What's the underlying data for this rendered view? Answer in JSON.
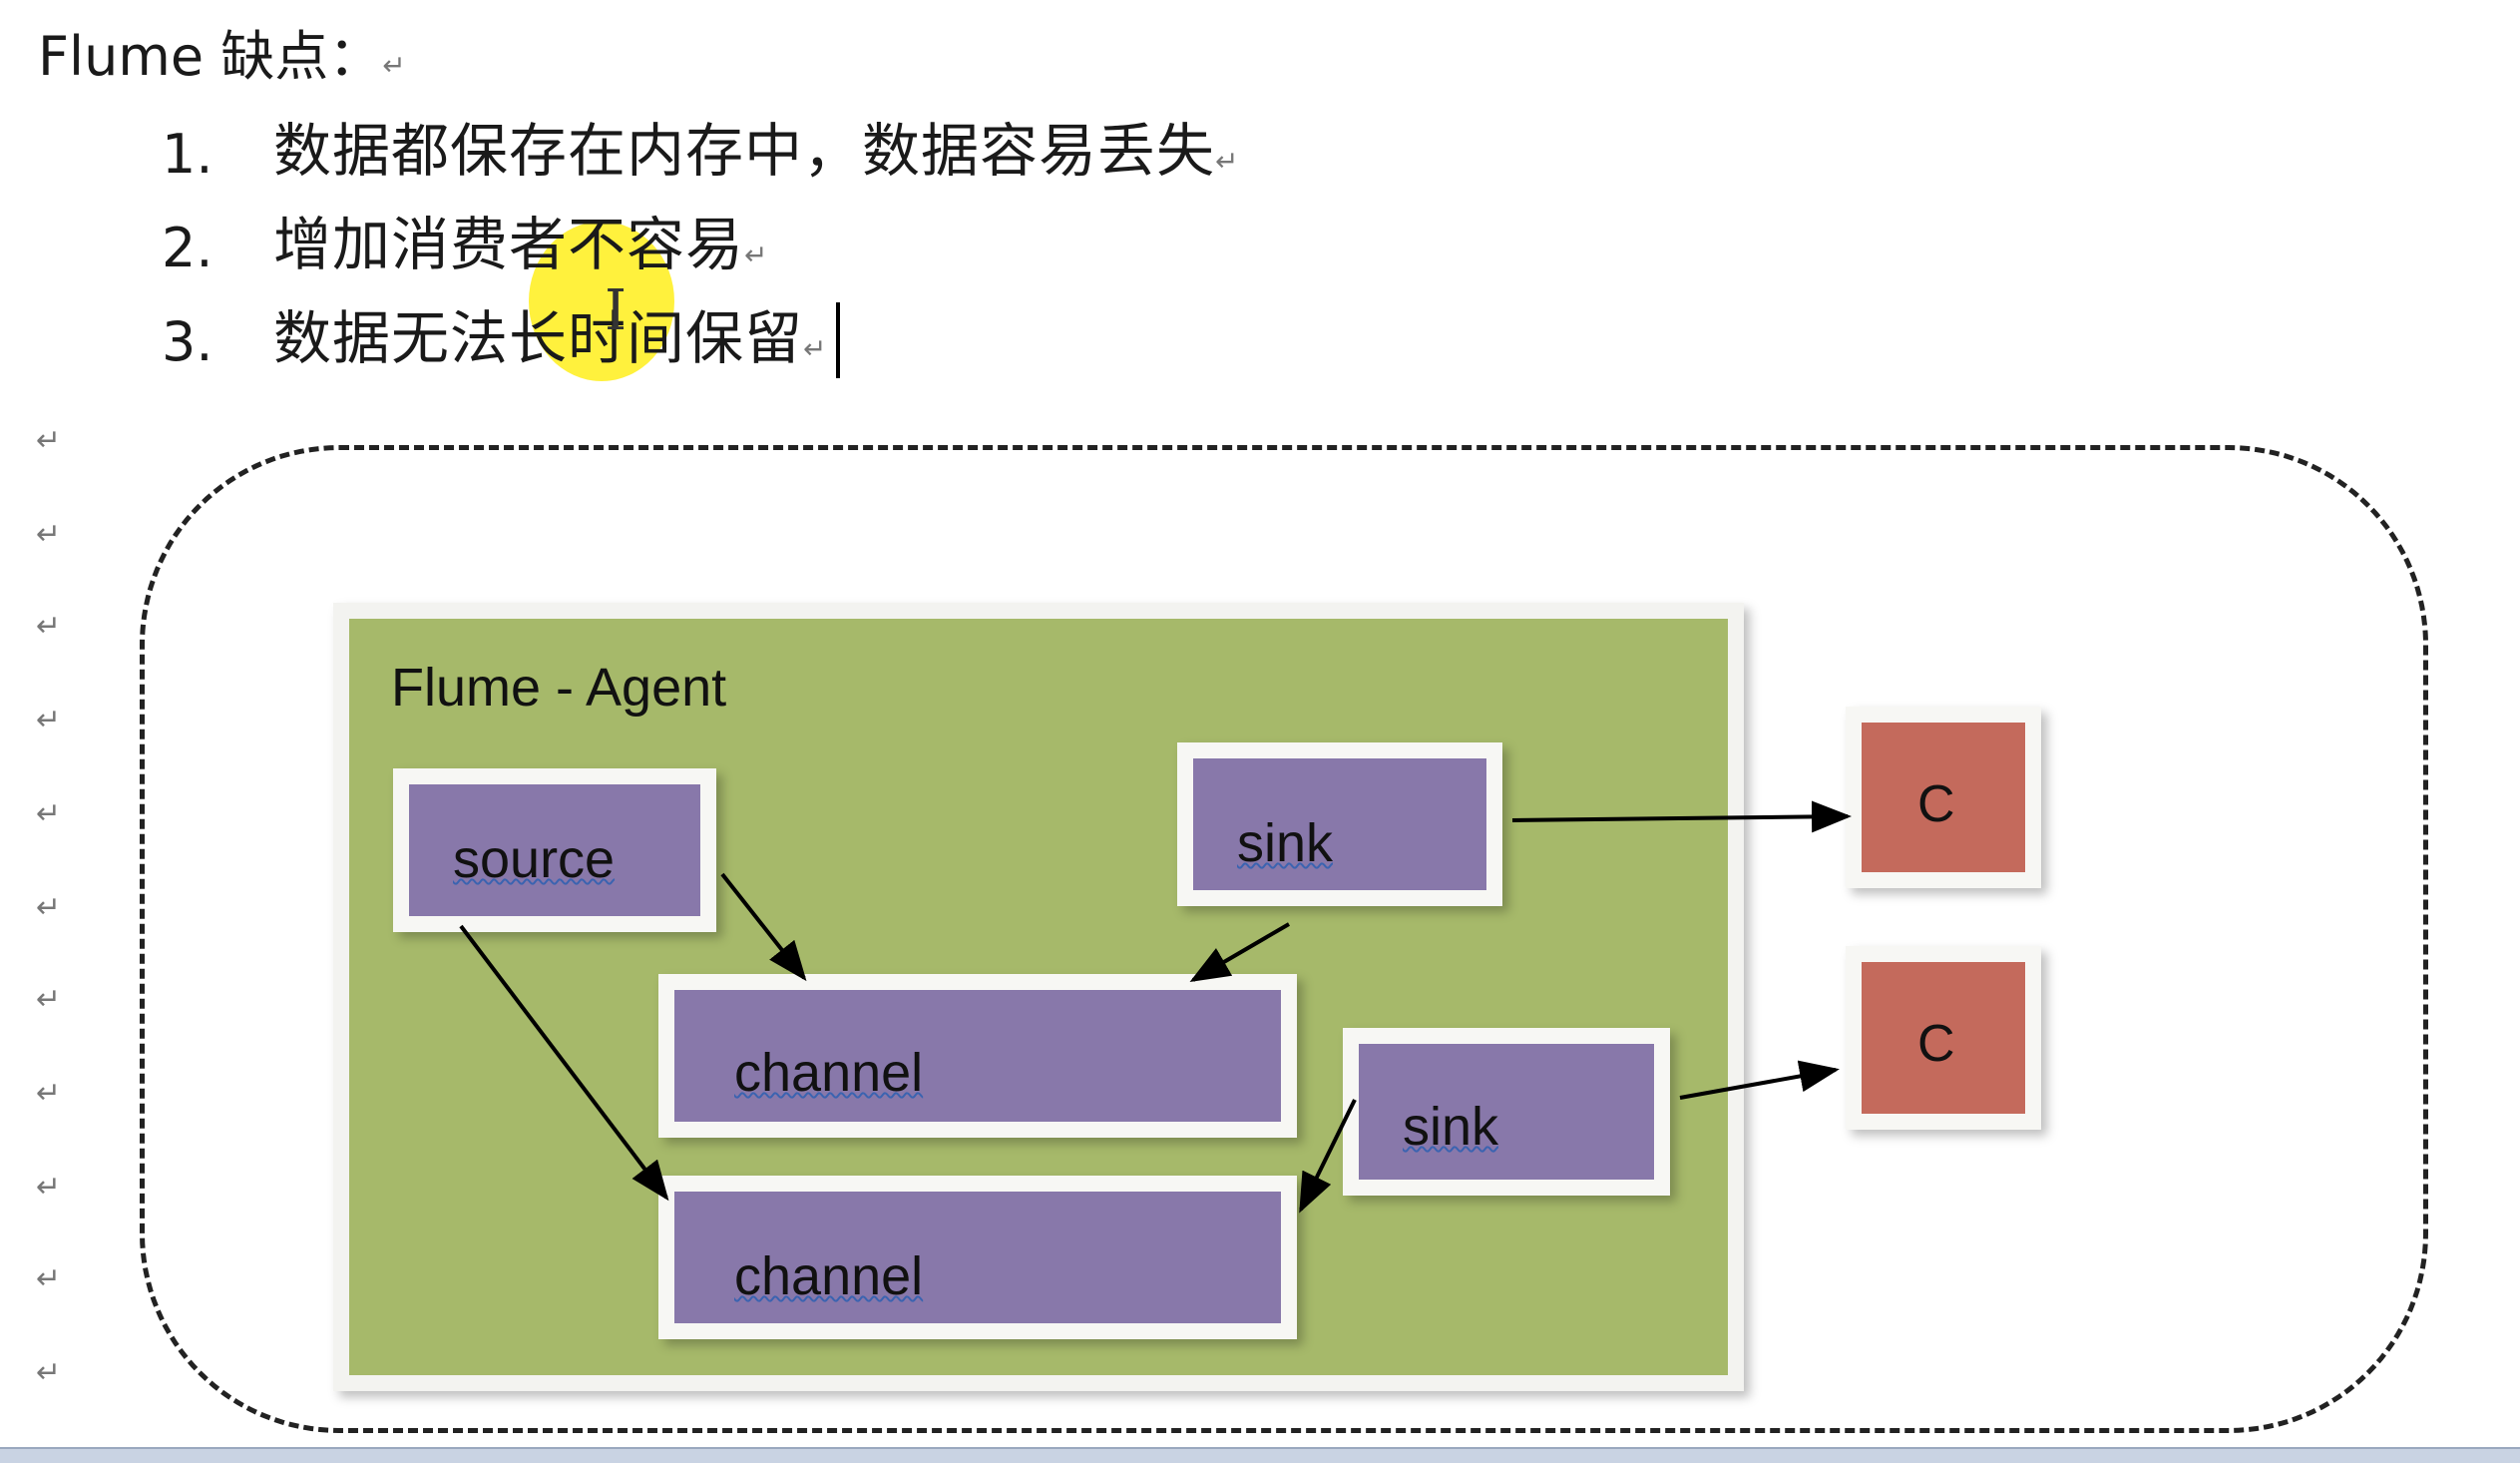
{
  "document": {
    "heading": "Flume 缺点：",
    "return_mark": "↵",
    "list": [
      {
        "num": "1.",
        "text": "数据都保存在内存中，数据容易丢失"
      },
      {
        "num": "2.",
        "text": "增加消费者不容易"
      },
      {
        "num": "3.",
        "text": "数据无法长时间保留"
      }
    ]
  },
  "diagram": {
    "agent_title": "Flume - Agent",
    "source_label": "source",
    "channel_top_label": "channel",
    "channel_bottom_label": "channel",
    "sink_top_label": "sink",
    "sink_bottom_label": "sink",
    "consumer_top_label": "C",
    "consumer_bottom_label": "C"
  },
  "colors": {
    "agent_fill": "#a6b96a",
    "component_fill": "#8878aa",
    "consumer_fill": "#c46a5c",
    "cursor_highlight": "#fff028"
  }
}
